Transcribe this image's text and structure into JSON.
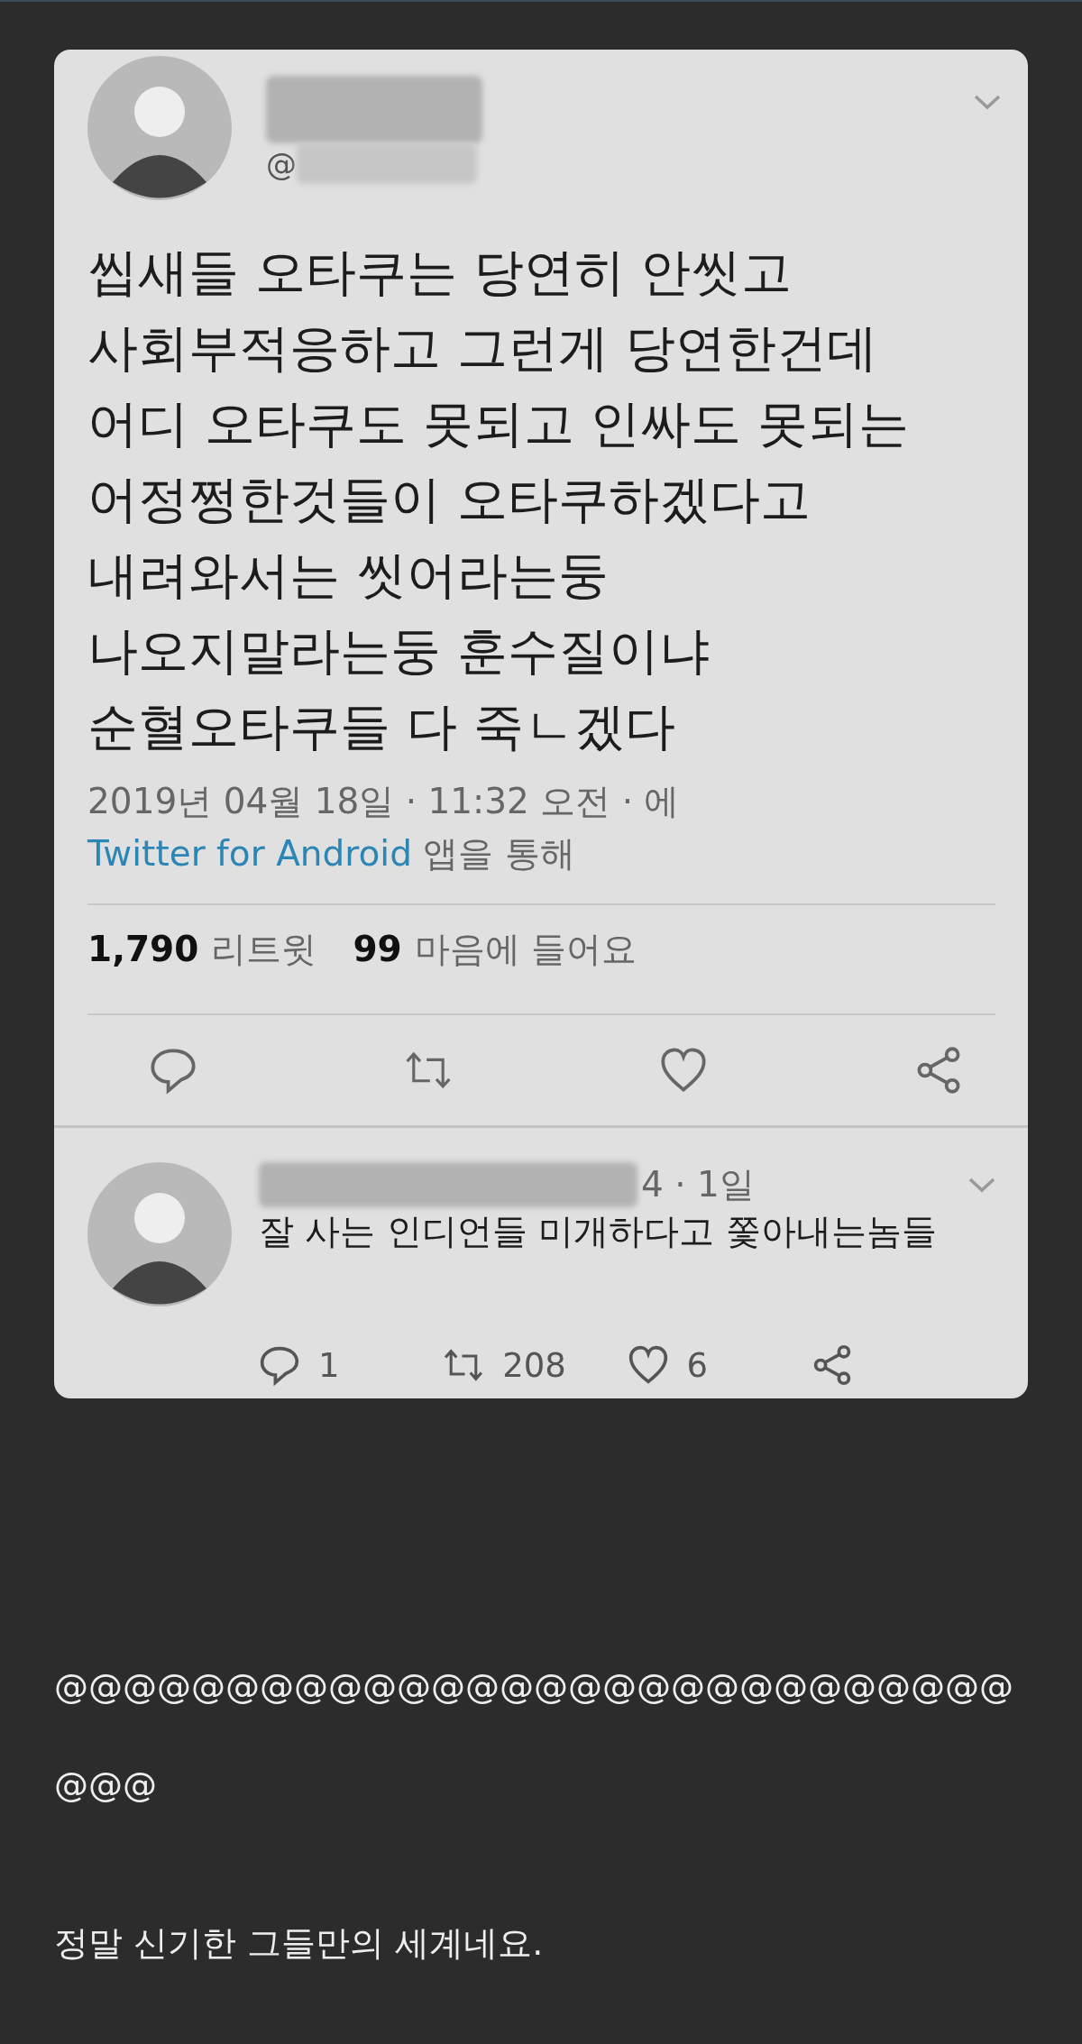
{
  "tweet": {
    "text_lines": [
      "씹새들 오타쿠는 당연히 안씻고",
      "사회부적응하고 그런게 당연한건데",
      "어디 오타쿠도 못되고 인싸도 못되는",
      "어정쩡한것들이 오타쿠하겠다고",
      "내려와서는 씻어라는둥",
      "나오지말라는둥 훈수질이냐",
      "순혈오타쿠들 다 죽ㄴ겠다"
    ],
    "handle_prefix": "@",
    "timestamp": "2019년 04월 18일 · 11:32 오전 · 에 ",
    "source_link": "Twitter for Android",
    "source_suffix": " 앱을 통해",
    "retweet_count": "1,790",
    "retweet_label": "리트윗",
    "like_count": "99",
    "like_label": "마음에 들어요"
  },
  "reply": {
    "time": "4 · 1일",
    "text": "잘 사는 인디언들 미개하다고 쫓아내는놈들",
    "reply_count": "1",
    "retweet_count": "208",
    "like_count": "6"
  },
  "post": {
    "symbols": "@@@@@@@@@@@@@@@@@@@@@@@@@@@@@@@",
    "comment": "정말 신기한 그들만의 세계네요."
  }
}
